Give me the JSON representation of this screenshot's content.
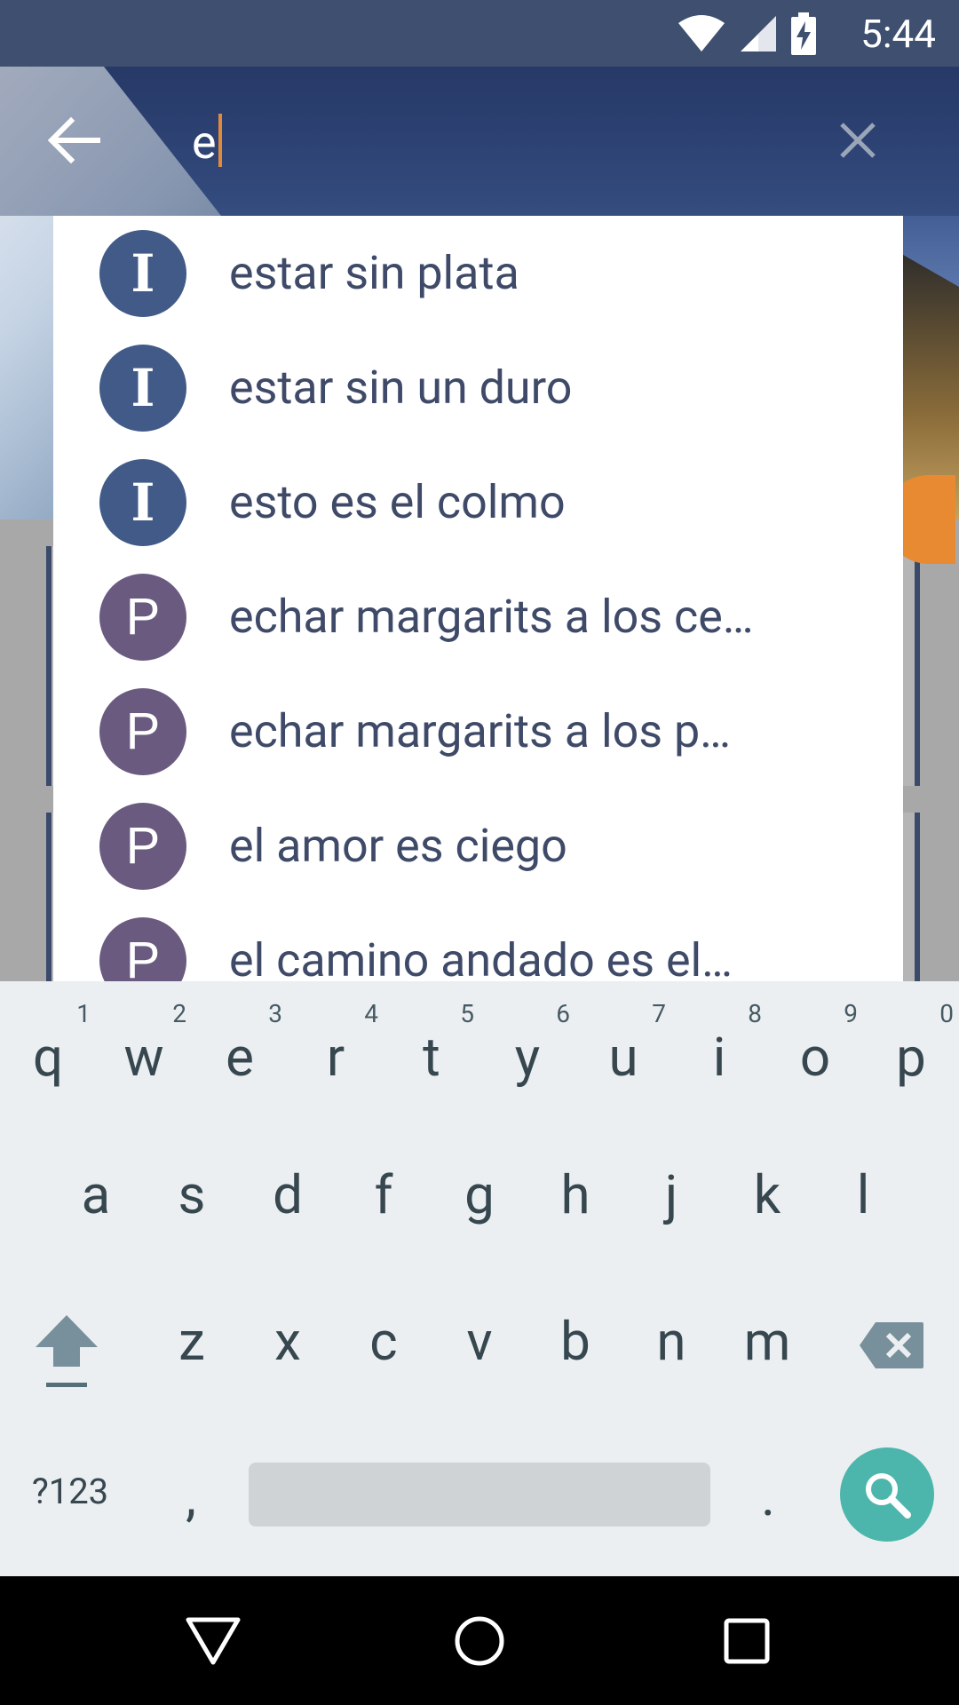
{
  "status_bar": {
    "time": "5:44"
  },
  "search": {
    "query": "e"
  },
  "suggestions": [
    {
      "badge": "I",
      "type": "idiom",
      "text": "estar sin plata"
    },
    {
      "badge": "I",
      "type": "idiom",
      "text": "estar sin un duro"
    },
    {
      "badge": "I",
      "type": "idiom",
      "text": "esto es el colmo"
    },
    {
      "badge": "P",
      "type": "proverb",
      "text": "echar margarits a los ce…"
    },
    {
      "badge": "P",
      "type": "proverb",
      "text": "echar margarits a los p…"
    },
    {
      "badge": "P",
      "type": "proverb",
      "text": "el amor es ciego"
    },
    {
      "badge": "P",
      "type": "proverb",
      "text": "el camino andado es el…"
    }
  ],
  "keyboard": {
    "row1": [
      {
        "k": "q",
        "h": "1"
      },
      {
        "k": "w",
        "h": "2"
      },
      {
        "k": "e",
        "h": "3"
      },
      {
        "k": "r",
        "h": "4"
      },
      {
        "k": "t",
        "h": "5"
      },
      {
        "k": "y",
        "h": "6"
      },
      {
        "k": "u",
        "h": "7"
      },
      {
        "k": "i",
        "h": "8"
      },
      {
        "k": "o",
        "h": "9"
      },
      {
        "k": "p",
        "h": "0"
      }
    ],
    "row2": [
      "a",
      "s",
      "d",
      "f",
      "g",
      "h",
      "j",
      "k",
      "l"
    ],
    "row3": [
      "z",
      "x",
      "c",
      "v",
      "b",
      "n",
      "m"
    ],
    "symbols_label": "?123",
    "comma": ",",
    "period": "."
  },
  "icons": {
    "back": "arrow-back-icon",
    "clear": "close-icon",
    "shift": "shift-icon",
    "backspace": "backspace-icon",
    "search": "search-icon",
    "nav_back": "nav-back-icon",
    "nav_home": "nav-home-icon",
    "nav_recents": "nav-recents-icon"
  },
  "colors": {
    "status_bar": "#3e4f6f",
    "idiom_badge": "#415a87",
    "proverb_badge": "#6a5a80",
    "suggestion_text": "#3e4a68",
    "search_key": "#4db6ac",
    "cursor": "#e08a3a"
  }
}
